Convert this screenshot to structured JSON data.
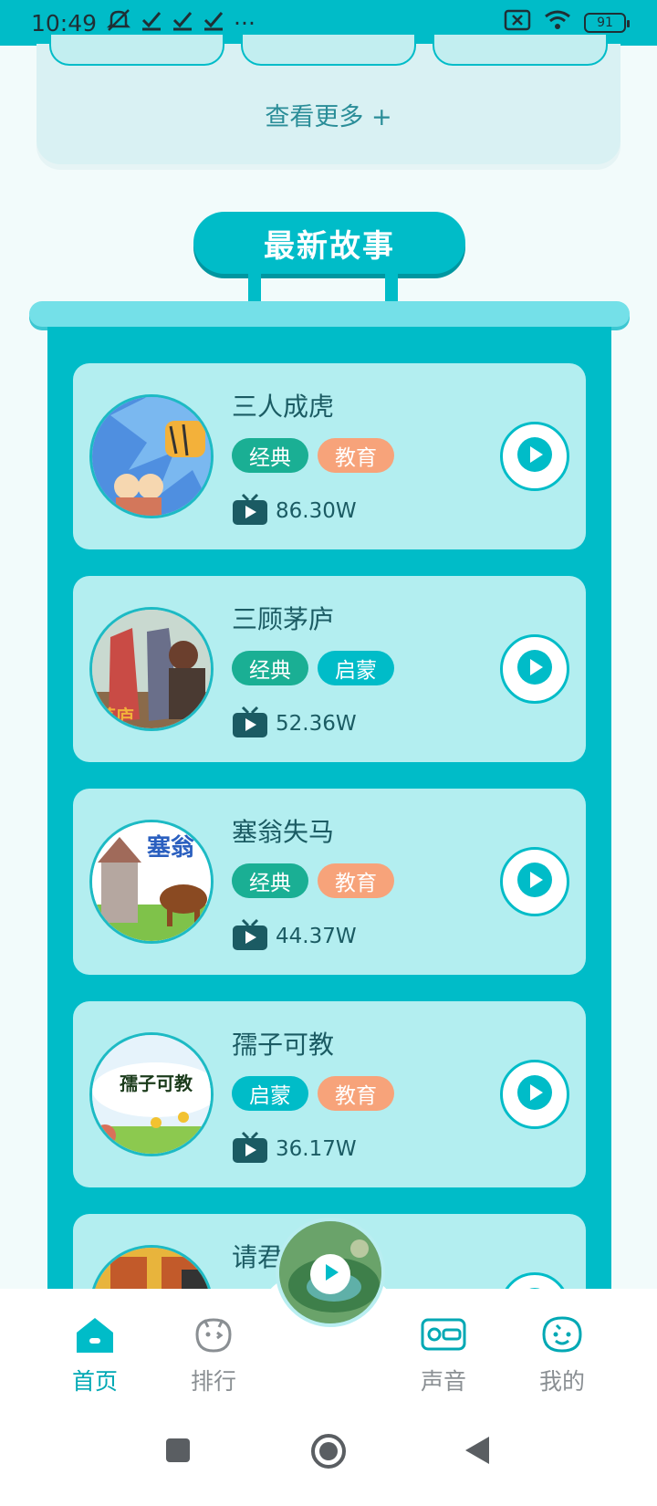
{
  "status": {
    "time": "10:49",
    "notification_icons": [
      "silent-icon",
      "check-icon",
      "check-icon",
      "check-icon"
    ],
    "more": "···",
    "battery": "91"
  },
  "top_panel": {
    "see_more": "查看更多 +"
  },
  "section": {
    "title": "最新故事"
  },
  "stories": [
    {
      "title": "三人成虎",
      "tags": [
        {
          "label": "经典",
          "color": "green"
        },
        {
          "label": "教育",
          "color": "orange"
        }
      ],
      "plays": "86.30W"
    },
    {
      "title": "三顾茅庐",
      "tags": [
        {
          "label": "经典",
          "color": "green"
        },
        {
          "label": "启蒙",
          "color": "teal"
        }
      ],
      "plays": "52.36W"
    },
    {
      "title": "塞翁失马",
      "tags": [
        {
          "label": "经典",
          "color": "green"
        },
        {
          "label": "教育",
          "color": "orange"
        }
      ],
      "plays": "44.37W"
    },
    {
      "title": "孺子可教",
      "tags": [
        {
          "label": "启蒙",
          "color": "teal"
        },
        {
          "label": "教育",
          "color": "orange"
        }
      ],
      "plays": "36.17W"
    },
    {
      "title": "请君",
      "tags": [],
      "plays": ""
    }
  ],
  "bottom_nav": {
    "home": "首页",
    "rank": "排行",
    "sound": "声音",
    "mine": "我的"
  },
  "colors": {
    "accent": "#00bcc8",
    "card": "#b3eef0",
    "tag_green": "#1aaf94",
    "tag_orange": "#f7a37a"
  }
}
